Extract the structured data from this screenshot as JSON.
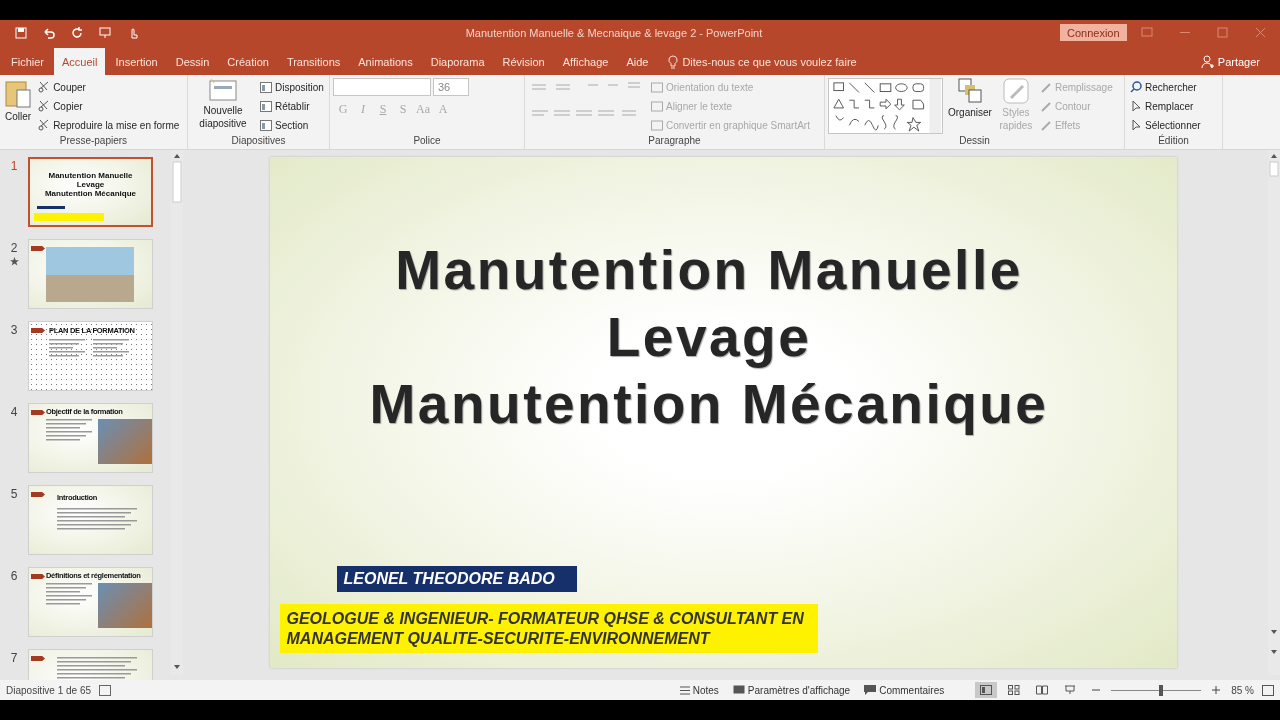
{
  "window": {
    "title": "Manutention Manuelle & Mecnaique & levage 2  -  PowerPoint",
    "signin": "Connexion",
    "share": "Partager"
  },
  "tabs": [
    {
      "label": "Fichier",
      "selected": false
    },
    {
      "label": "Accueil",
      "selected": true
    },
    {
      "label": "Insertion",
      "selected": false
    },
    {
      "label": "Dessin",
      "selected": false
    },
    {
      "label": "Création",
      "selected": false
    },
    {
      "label": "Transitions",
      "selected": false
    },
    {
      "label": "Animations",
      "selected": false
    },
    {
      "label": "Diaporama",
      "selected": false
    },
    {
      "label": "Révision",
      "selected": false
    },
    {
      "label": "Affichage",
      "selected": false
    },
    {
      "label": "Aide",
      "selected": false
    }
  ],
  "tell_me": "Dites-nous ce que vous voulez faire",
  "ribbon": [
    {
      "kind": "clipboard",
      "name": "Presse-papiers",
      "big": {
        "label": "Coller",
        "disabled": false
      },
      "items": [
        {
          "label": "Couper",
          "disabled": false
        },
        {
          "label": "Copier",
          "disabled": false
        },
        {
          "label": "Reproduire la mise en forme",
          "disabled": false
        }
      ]
    },
    {
      "kind": "slides",
      "name": "Diapositives",
      "big": {
        "label": "Nouvelle diapositive",
        "disabled": false
      },
      "items": [
        {
          "label": "Disposition",
          "disabled": false
        },
        {
          "label": "Rétablir",
          "disabled": false
        },
        {
          "label": "Section",
          "disabled": false
        }
      ]
    },
    {
      "kind": "font",
      "name": "Police",
      "size": "36",
      "items": [
        {
          "label": "G",
          "disabled": true
        },
        {
          "label": "I",
          "disabled": true
        },
        {
          "label": "S",
          "disabled": true
        },
        {
          "label": "S",
          "disabled": true
        },
        {
          "label": "Aa",
          "disabled": true
        },
        {
          "label": "A",
          "disabled": true
        }
      ]
    },
    {
      "kind": "paragraph",
      "name": "Paragraphe",
      "items": [
        {
          "label": "Orientation du texte",
          "disabled": true
        },
        {
          "label": "Aligner le texte",
          "disabled": true
        },
        {
          "label": "Convertir en graphique SmartArt",
          "disabled": true
        }
      ]
    },
    {
      "kind": "drawing",
      "name": "Dessin",
      "big": {
        "label": "Organiser",
        "disabled": false
      },
      "big2": {
        "label": "Styles rapides",
        "disabled": true
      },
      "items": [
        {
          "label": "Remplissage",
          "disabled": true
        },
        {
          "label": "Contour",
          "disabled": true
        },
        {
          "label": "Effets",
          "disabled": true
        }
      ]
    },
    {
      "kind": "editing",
      "name": "Édition",
      "items": [
        {
          "label": "Rechercher",
          "disabled": false
        },
        {
          "label": "Remplacer",
          "disabled": false
        },
        {
          "label": "Sélectionner",
          "disabled": false
        }
      ]
    }
  ],
  "thumbnails": [
    {
      "number": "1",
      "selected": true,
      "starred": false,
      "kind": "cover",
      "title_lines": [
        "Manutention Manuelle",
        "Levage",
        "Manutention Mécanique"
      ]
    },
    {
      "number": "2",
      "selected": false,
      "starred": true,
      "kind": "photo"
    },
    {
      "number": "3",
      "selected": false,
      "starred": false,
      "kind": "columns",
      "title_lines": [
        "PLAN DE LA FORMATION"
      ]
    },
    {
      "number": "4",
      "selected": false,
      "starred": false,
      "kind": "text_photo",
      "title_lines": [
        "Objectif de la formation"
      ]
    },
    {
      "number": "5",
      "selected": false,
      "starred": false,
      "kind": "text",
      "title_lines": [
        "Introduction"
      ]
    },
    {
      "number": "6",
      "selected": false,
      "starred": false,
      "kind": "text_photo",
      "title_lines": [
        "Définitions et réglementation"
      ]
    },
    {
      "number": "7",
      "selected": false,
      "starred": false,
      "kind": "text"
    }
  ],
  "slide": {
    "title_lines": [
      "Manutention Manuelle",
      "Levage",
      "Manutention Mécanique"
    ],
    "author": "LEONEL THEODORE BADO",
    "subtitle_lines": [
      "GEOLOGUE & INGENIEUR- FORMATEUR QHSE & CONSULTANT EN",
      "MANAGEMENT QUALITE-SECURITE-ENVIRONNEMENT"
    ]
  },
  "status_bar": {
    "slide_counter": "Diapositive 1 de 65",
    "notes": "Notes",
    "display": "Paramètres d'affichage",
    "comments": "Commentaires",
    "views": [
      {
        "kind": "normal",
        "selected": true
      },
      {
        "kind": "sorter",
        "selected": false
      },
      {
        "kind": "reading",
        "selected": false
      },
      {
        "kind": "show",
        "selected": false
      }
    ],
    "zoom": {
      "level": 0.55,
      "reading": "85 %"
    }
  }
}
